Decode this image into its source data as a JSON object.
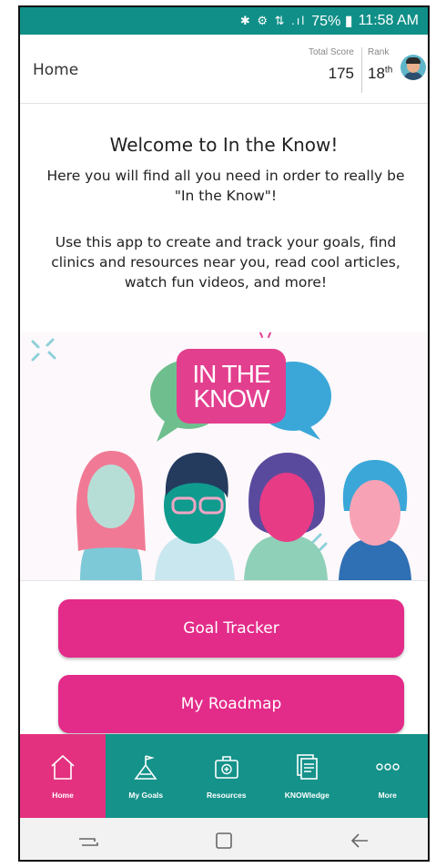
{
  "status_bar": {
    "icons": "✱ ⚙ ⇅ .ıl",
    "battery": "75%",
    "time": "11:58 AM"
  },
  "header": {
    "title": "Home",
    "total_score_label": "Total Score",
    "total_score_value": "175",
    "rank_label": "Rank",
    "rank_value": "18",
    "rank_suffix": "th"
  },
  "welcome": {
    "title": "Welcome to In the Know!",
    "line1": "Here you will find all you need in order to really be \"In the Know\"!",
    "line2": "Use this app to create and track your goals, find clinics and resources near you, read cool articles, watch fun videos, and more!"
  },
  "illustration": {
    "logo_line1": "IN THE",
    "logo_line2": "KNOW"
  },
  "buttons": {
    "goal_tracker": "Goal Tracker",
    "my_roadmap": "My Roadmap"
  },
  "bottom_nav": {
    "items": [
      {
        "label": "Home",
        "icon": "home-icon",
        "active": true
      },
      {
        "label": "My Goals",
        "icon": "flag-mountain-icon",
        "active": false
      },
      {
        "label": "Resources",
        "icon": "first-aid-kit-icon",
        "active": false
      },
      {
        "label": "KNOWledge",
        "icon": "documents-icon",
        "active": false
      },
      {
        "label": "More",
        "icon": "more-dots-icon",
        "active": false
      }
    ]
  },
  "colors": {
    "teal": "#15928a",
    "pink": "#e32b89"
  }
}
